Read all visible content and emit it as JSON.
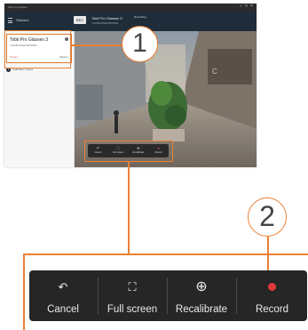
{
  "screenshot": {
    "title_bar": "tobii pro glasses",
    "app_label": "Glasses",
    "recording_tag": "REC",
    "device_name": "Tobii Pro Glasses 3",
    "device_serial": "TG03B-080200055681",
    "battery": "Recording",
    "sidebar": {
      "card_name": "Tobii Pro Glasses 3",
      "card_serial": "TG03B-080200055681",
      "card_indicator": "Stream",
      "card_battery": "Battery",
      "row_number": "1",
      "row_label": "Calibration status"
    },
    "mini_controls": [
      {
        "icon": "↶",
        "label": "Cancel"
      },
      {
        "icon": "⛶",
        "label": "Full screen"
      },
      {
        "icon": "⊕",
        "label": "Recalibrate"
      },
      {
        "icon": "●",
        "label": "Record"
      }
    ]
  },
  "callouts": {
    "one": "1",
    "two": "2"
  },
  "controls": {
    "cancel": {
      "icon": "↶",
      "label": "Cancel"
    },
    "fullscreen": {
      "icon": "⛶",
      "label": "Full screen"
    },
    "recalibrate": {
      "icon": "⊕",
      "label": "Recalibrate"
    },
    "record": {
      "label": "Record"
    }
  },
  "colors": {
    "accent": "#ea8034",
    "controls_bg": "#262626",
    "record": "#e0393c"
  }
}
